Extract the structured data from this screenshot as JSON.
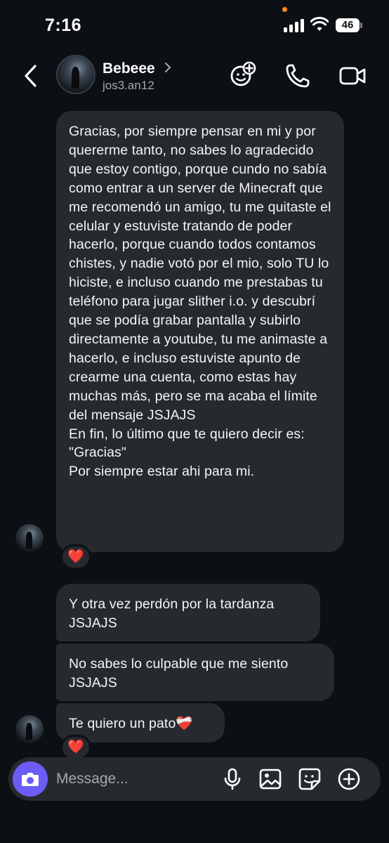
{
  "status": {
    "time": "7:16",
    "battery": "46"
  },
  "header": {
    "name": "Bebeee",
    "username": "jos3.an12"
  },
  "messages": [
    {
      "paragraphs": [
        "Gracias, por siempre pensar en mi y por quererme tanto, no sabes lo agradecido que estoy contigo, porque cundo no sabía como entrar a un server de Minecraft que me recomendó un amigo, tu me quitaste el celular y estuviste tratando de poder hacerlo, porque cuando todos contamos chistes, y nadie votó por el mio, solo TU lo hiciste, e incluso cuando me prestabas tu teléfono para jugar slither i.o. y descubrí que se podía grabar pantalla y subirlo directamente a youtube, tu me animaste a hacerlo, e incluso estuviste apunto de crearme una cuenta, como estas hay muchas más, pero se ma acaba el límite del mensaje JSJAJS",
        "En fin, lo último que te quiero decir es: \"Gracias\"",
        "Por siempre estar ahi para mi."
      ],
      "reaction": "❤️"
    },
    {
      "text": "Y otra vez perdón por la tardanza JSJAJS"
    },
    {
      "text": "No sabes lo culpable que me siento JSJAJS"
    },
    {
      "text": "Te quiero un pato❤️‍🩹",
      "reaction": "❤️"
    }
  ],
  "composer": {
    "placeholder": "Message..."
  },
  "icons": [
    "back-icon",
    "chevron-right-icon",
    "effects-icon",
    "phone-icon",
    "video-icon",
    "camera-icon",
    "microphone-icon",
    "gallery-icon",
    "sticker-icon",
    "plus-icon"
  ],
  "colors": {
    "background": "#0c1014",
    "bubble": "#262a2f",
    "accent": "#6b5cf6",
    "secondary_text": "#a8a8a8"
  }
}
